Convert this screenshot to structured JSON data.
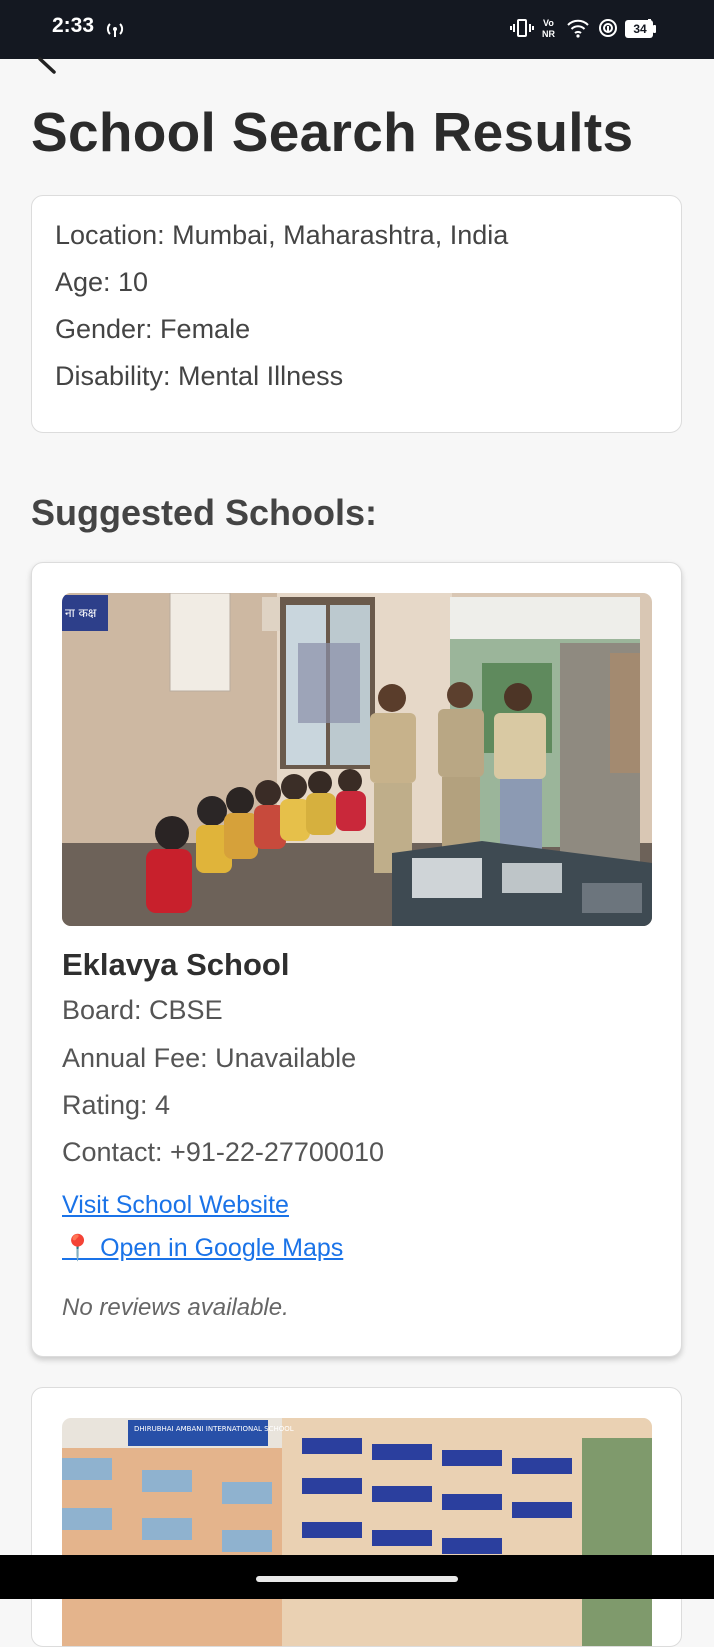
{
  "status_bar": {
    "time": "2:33",
    "battery": "34",
    "icons": [
      "hotspot-icon",
      "vibrate-icon",
      "volte-icon",
      "wifi-icon",
      "nfc-icon",
      "signal-icon",
      "battery-icon"
    ],
    "vo_top": "Vo",
    "vo_bottom": "NR"
  },
  "header": {
    "back_icon": "back-arrow-icon",
    "title": "School Search Results"
  },
  "search_info": {
    "location": "Location: Mumbai, Maharashtra, India",
    "age": "Age: 10",
    "gender": "Gender: Female",
    "disability": "Disability: Mental Illness"
  },
  "suggested": {
    "heading": "Suggested Schools:",
    "schools": [
      {
        "name": "Eklavya School",
        "board": "Board: CBSE",
        "fee": "Annual Fee: Unavailable",
        "rating": "Rating: 4",
        "contact": "Contact: +91-22-27700010",
        "website_link": "Visit School Website",
        "maps_link": "📍 Open in Google Maps",
        "reviews": "No reviews available.",
        "photo_sign": "ना कक्ष"
      },
      {
        "photo_sign": "DHIRUBHAI AMBANI INTERNATIONAL SCHOOL"
      }
    ]
  },
  "colors": {
    "status_bar": "#141821",
    "link": "#1a73e8",
    "background": "#f7f7f7"
  }
}
